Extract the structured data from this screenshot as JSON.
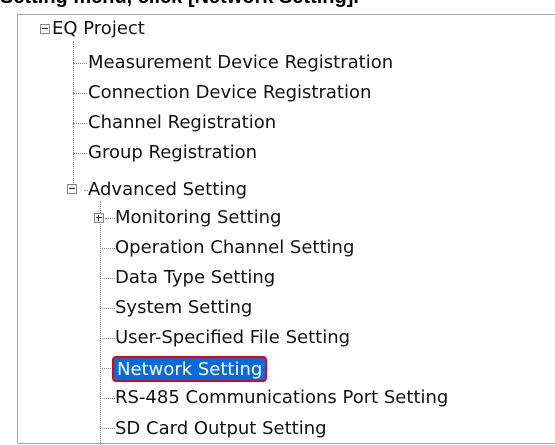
{
  "caption": "Setting menu, click [Network Setting].",
  "tree": {
    "root": "EQ Project",
    "items": [
      "Measurement Device Registration",
      "Connection Device Registration",
      "Channel Registration",
      "Group Registration"
    ],
    "advanced": {
      "label": "Advanced Setting",
      "children": [
        "Monitoring Setting",
        "Operation Channel Setting",
        "Data Type Setting",
        "System Setting",
        "User-Specified File Setting",
        "Network Setting",
        "RS-485 Communications Port Setting",
        "SD Card Output Setting"
      ]
    }
  },
  "colors": {
    "selection": "#0a6ad8",
    "highlight_border": "#e60012"
  }
}
